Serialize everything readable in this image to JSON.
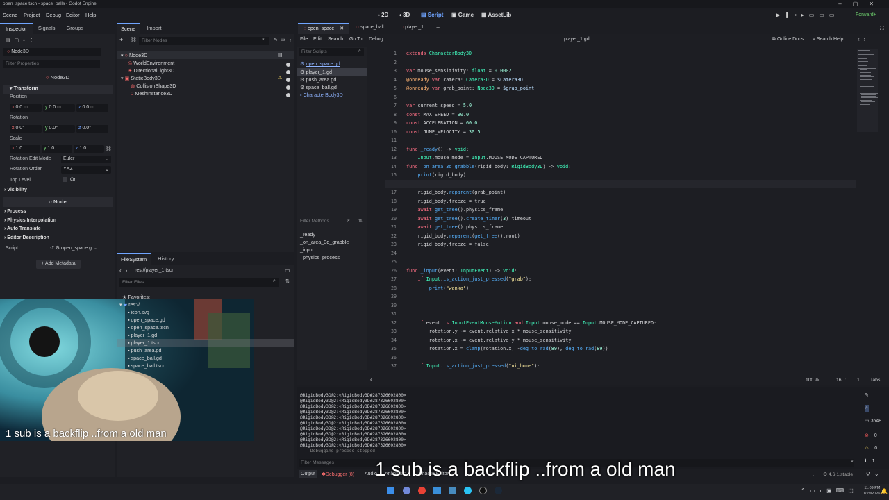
{
  "window_title": "open_space.tscn - space_balls - Godot Engine",
  "menus": [
    "Scene",
    "Project",
    "Debug",
    "Editor",
    "Help"
  ],
  "workspaces": [
    "2D",
    "3D",
    "Script",
    "Game",
    "AssetLib"
  ],
  "renderer": "Forward+",
  "left_tabs": [
    "Inspector",
    "Signals",
    "Groups"
  ],
  "inspector": {
    "node": "Node3D",
    "filter_placeholder": "Filter Properties",
    "class_title": "Node3D",
    "transform": "Transform",
    "position": "Position",
    "rotation": "Rotation",
    "scale": "Scale",
    "pos_vals": [
      "0.0",
      "0.0",
      "0.0"
    ],
    "pos_unit": "m",
    "rot_vals": [
      "0.0",
      "0.0",
      "0.0"
    ],
    "rot_unit": "°",
    "scale_vals": [
      "1.0",
      "1.0",
      "1.0"
    ],
    "axes": [
      "x",
      "y",
      "z"
    ],
    "rotation_edit_mode": "Rotation Edit Mode",
    "rotation_edit_value": "Euler",
    "rotation_order": "Rotation Order",
    "rotation_order_value": "YXZ",
    "top_level": "Top Level",
    "top_level_value": "On",
    "visibility": "Visibility",
    "node_title": "Node",
    "process": "Process",
    "physics_interp": "Physics Interpolation",
    "auto_translate": "Auto Translate",
    "editor_desc": "Editor Description",
    "script": "Script",
    "script_value": "open_space.g",
    "add_metadata": "Add Metadata"
  },
  "scene_tabs": [
    "Scene",
    "Import"
  ],
  "scene_filter": "Filter Nodes",
  "tree": [
    "Node3D",
    "WorldEnvironment",
    "DirectionalLight3D",
    "StaticBody3D",
    "CollisionShape3D",
    "MeshInstance3D"
  ],
  "fs_tabs": [
    "FileSystem",
    "History"
  ],
  "fs_path": "res://player_1.tscn",
  "fs_filter": "Filter Files",
  "fs_items": [
    "Favorites:",
    "res://",
    "icon.svg",
    "open_space.gd",
    "open_space.tscn",
    "player_1.gd",
    "player_1.tscn",
    "push_area.gd",
    "space_ball.gd",
    "space_ball.tscn"
  ],
  "editor_tabs": [
    "open_space",
    "space_ball",
    "player_1"
  ],
  "script_menu": [
    "File",
    "Edit",
    "Search",
    "Go To",
    "Debug"
  ],
  "script_file": "player_1.gd",
  "online_docs": "Online Docs",
  "search_help": "Search Help",
  "filter_scripts": "Filter Scripts",
  "scripts": [
    "open_space.gd",
    "player_1.gd",
    "push_area.gd",
    "space_ball.gd",
    "CharacterBody3D"
  ],
  "filter_methods": "Filter Methods",
  "methods": [
    "_ready",
    "_on_area_3d_grabble",
    "_input",
    "_physics_process"
  ],
  "code": [
    [
      "1",
      "extends CharacterBody3D"
    ],
    [
      "2",
      ""
    ],
    [
      "3",
      "var mouse_sensitivity: float = 0.0002"
    ],
    [
      "4",
      "@onready var camera: Camera3D = $Camera3D"
    ],
    [
      "5",
      "@onready var grab_point: Node3D = $grab_point"
    ],
    [
      "6",
      ""
    ],
    [
      "7",
      "var current_speed = 5.0"
    ],
    [
      "8",
      "const MAX_SPEED = 90.0"
    ],
    [
      "9",
      "const ACCELERATION = 60.0"
    ],
    [
      "10",
      "const JUMP_VELOCITY = 30.5"
    ],
    [
      "11",
      ""
    ],
    [
      "12",
      "func _ready() -> void:"
    ],
    [
      "13",
      "    Input.mouse_mode = Input.MOUSE_MODE_CAPTURED"
    ],
    [
      "14",
      "func _on_area_3d_grabble(rigid_body: RigidBody3D) -> void:"
    ],
    [
      "15",
      "    print(rigid_body)"
    ],
    [
      "16",
      ""
    ],
    [
      "17",
      "    rigid_body.reparent(grab_point)"
    ],
    [
      "18",
      "    rigid_body.freeze = true"
    ],
    [
      "19",
      "    await get_tree().physics_frame"
    ],
    [
      "20",
      "    await get_tree().create_timer(3).timeout"
    ],
    [
      "21",
      "    await get_tree().physics_frame"
    ],
    [
      "22",
      "    rigid_body.reparent(get_tree().root)"
    ],
    [
      "23",
      "    rigid_body.freeze = false"
    ],
    [
      "24",
      ""
    ],
    [
      "25",
      ""
    ],
    [
      "26",
      "func _input(event: InputEvent) -> void:"
    ],
    [
      "27",
      "    if Input.is_action_just_pressed(\"grab\"):"
    ],
    [
      "28",
      "        print(\"wanka\")"
    ],
    [
      "29",
      ""
    ],
    [
      "30",
      ""
    ],
    [
      "31",
      ""
    ],
    [
      "32",
      "    if event is InputEventMouseMotion and Input.mouse_mode == Input.MOUSE_MODE_CAPTURED:"
    ],
    [
      "33",
      "        rotation.y -= event.relative.x * mouse_sensitivity"
    ],
    [
      "34",
      "        rotation.x -= event.relative.y * mouse_sensitivity"
    ],
    [
      "35",
      "        rotation.x = clamp(rotation.x, -deg_to_rad(89), deg_to_rad(89))"
    ],
    [
      "36",
      ""
    ],
    [
      "37",
      "    if Input.is_action_just_pressed(\"ui_home\"):"
    ]
  ],
  "status": {
    "zoom": "100 %",
    "line": "16",
    "col": "1",
    "indent": "Tabs"
  },
  "output_lines": [
    "@RigidBody3D@2:<RigidBody3D#287326602800>",
    "@RigidBody3D@2:<RigidBody3D#287326602800>",
    "@RigidBody3D@2:<RigidBody3D#287326602800>",
    "@RigidBody3D@2:<RigidBody3D#287326602800>",
    "@RigidBody3D@2:<RigidBody3D#287326602800>",
    "@RigidBody3D@2:<RigidBody3D#287326602800>",
    "@RigidBody3D@2:<RigidBody3D#287326602800>",
    "@RigidBody3D@2:<RigidBody3D#287326602800>",
    "@RigidBody3D@2:<RigidBody3D#287326602800>",
    "@RigidBody3D@2:<RigidBody3D#287326602800>",
    "--- Debugging process stopped ---"
  ],
  "filter_messages": "Filter Messages",
  "output_counts": {
    "all": "3648",
    "errors": "0",
    "warnings": "0",
    "messages": "1"
  },
  "bottom_tabs": [
    "Output",
    "Debugger (8)",
    "Audio",
    "Animation",
    "Shader Editor"
  ],
  "version": "4.6.1.stable",
  "caption": "1 sub is a backflip ..from a old man",
  "clock": {
    "time": "11:09 PM",
    "date": "1/29/2026"
  },
  "colors": {
    "accent": "#6fa4ff",
    "error": "#ff5d5d",
    "warning": "#ffdd65"
  }
}
